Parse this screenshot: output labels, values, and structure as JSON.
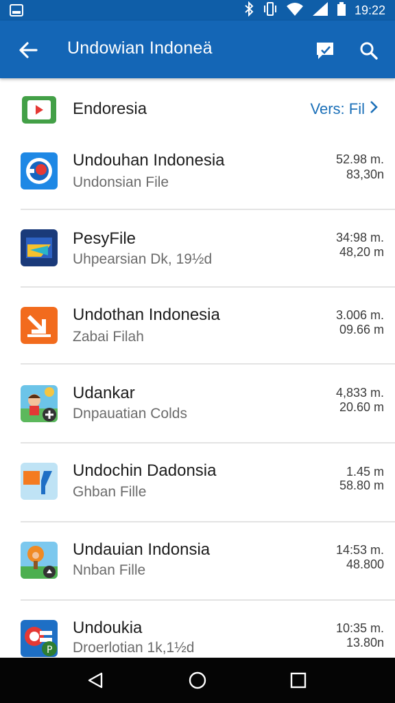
{
  "status_bar": {
    "time": "19:22",
    "icons": [
      "gallery-notification-icon",
      "bluetooth-icon",
      "vibrate-icon",
      "wifi-icon",
      "signal-icon",
      "battery-icon"
    ]
  },
  "app_bar": {
    "title": "Undowian Indoneä",
    "back_icon": "arrow-back-icon",
    "actions": [
      "feedback-icon",
      "search-icon"
    ]
  },
  "header_row": {
    "name": "Endoresia",
    "link": "Vers: Fil",
    "link_icon": "chevron-right-icon"
  },
  "items": [
    {
      "name": "Undouhan Indonesia",
      "sub": "Undonsian File",
      "meta1": "52.98 m.",
      "meta2": "83,30n",
      "icon": "blue-circle-app-icon"
    },
    {
      "name": "PesyFile",
      "sub": "Uhpearsian Dk, 19½d",
      "meta1": "34:98 m.",
      "meta2": "48,20 m",
      "icon": "navy-folder-app-icon"
    },
    {
      "name": "Undothan Indonesia",
      "sub": "Zabai Filah",
      "meta1": "3.006 m.",
      "meta2": "09.66 m",
      "icon": "orange-download-app-icon"
    },
    {
      "name": "Udankar",
      "sub": "Dnpauatian Colds",
      "meta1": "4,833 m.",
      "meta2": "20.60 m",
      "icon": "cartoon-kid-app-icon"
    },
    {
      "name": "Undochin Dadonsia",
      "sub": "Ghban Fille",
      "meta1": "1.45 m",
      "meta2": "58.80 m",
      "icon": "orange-blue-shapes-app-icon"
    },
    {
      "name": "Undauian Indonsia",
      "sub": "Nnban Fille",
      "meta1": "14:53 m.",
      "meta2": "48.800",
      "icon": "cartoon-tree-app-icon"
    },
    {
      "name": "Undoukia",
      "sub": "Droerlotian 1k,1½d",
      "meta1": "10:35 m.",
      "meta2": "13.80n",
      "icon": "red-p-badge-app-icon"
    }
  ],
  "nav_bar": {
    "icons": [
      "nav-back-icon",
      "nav-home-icon",
      "nav-recents-icon"
    ]
  },
  "colors": {
    "status_bar": "#0f5ea8",
    "app_bar": "#1466b6",
    "link": "#1a6fb8",
    "nav_bar": "#050505"
  }
}
